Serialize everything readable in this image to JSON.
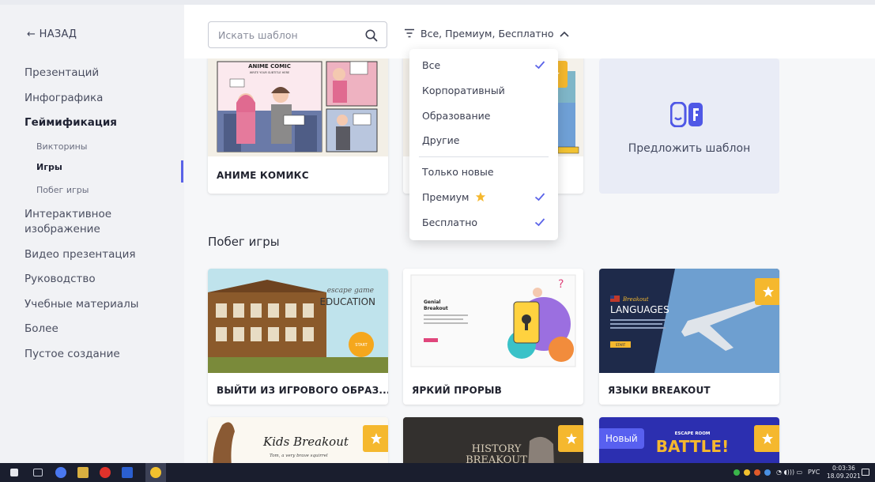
{
  "colors": {
    "accent": "#5a63e8",
    "star": "#f5b82e",
    "new_badge": "#5860f0"
  },
  "sidebar": {
    "back_label": "← НАЗАД",
    "items": [
      {
        "label": "Презентаций"
      },
      {
        "label": "Инфографика"
      },
      {
        "label": "Геймификация"
      },
      {
        "label": "Викторины"
      },
      {
        "label": "Игры"
      },
      {
        "label": "Побег игры"
      },
      {
        "label": "Интерактивное"
      },
      {
        "label": "изображение"
      },
      {
        "label": "Видео презентация"
      },
      {
        "label": "Руководство"
      },
      {
        "label": "Учебные материалы"
      },
      {
        "label": "Более"
      },
      {
        "label": "Пустое создание"
      }
    ]
  },
  "topbar": {
    "search_placeholder": "Искать шаблон",
    "filter_label": "Все, Премиум, Бесплатно"
  },
  "dropdown": {
    "items": [
      {
        "label": "Все",
        "checked": true
      },
      {
        "label": "Корпоративный",
        "checked": false
      },
      {
        "label": "Образование",
        "checked": false
      },
      {
        "label": "Другие",
        "checked": false
      },
      {
        "label": "Только новые",
        "checked": false
      },
      {
        "label": "Премиум",
        "checked": true
      },
      {
        "label": "Бесплатно",
        "checked": true
      }
    ]
  },
  "main": {
    "anime_card": {
      "title": "АНИМЕ КОМИКС",
      "image_heading": "ANIME COMIC",
      "image_subheading": "WRITE YOUR SUBTITLE HERE"
    },
    "suggest_label": "Предложить шаблон",
    "section_title": "Побег игры",
    "cards": [
      {
        "title": "ВЫЙТИ ИЗ ИГРОВОГО ОБРАЗ...",
        "image_lines": [
          "escape game",
          "EDUCATION"
        ],
        "button": "START"
      },
      {
        "title": "ЯРКИЙ ПРОРЫВ",
        "image_lines": [
          "Genial",
          "Breakout"
        ]
      },
      {
        "title": "ЯЗЫКИ BREAKOUT",
        "image_lines": [
          "Breakout",
          "LANGUAGES"
        ],
        "button": "START"
      }
    ],
    "bottom_cards": [
      {
        "image_lines": [
          "Kids Breakout",
          "Tom, a very brave squirrel"
        ]
      },
      {
        "image_lines": [
          "HISTORY",
          "BREAKOUT"
        ]
      },
      {
        "badge": "Новый",
        "image_lines": [
          "ESCAPE ROOM",
          "BATTLE!"
        ]
      }
    ]
  },
  "taskbar": {
    "lang": "РУС",
    "time": "0:03:36",
    "date": "18.09.2021"
  }
}
